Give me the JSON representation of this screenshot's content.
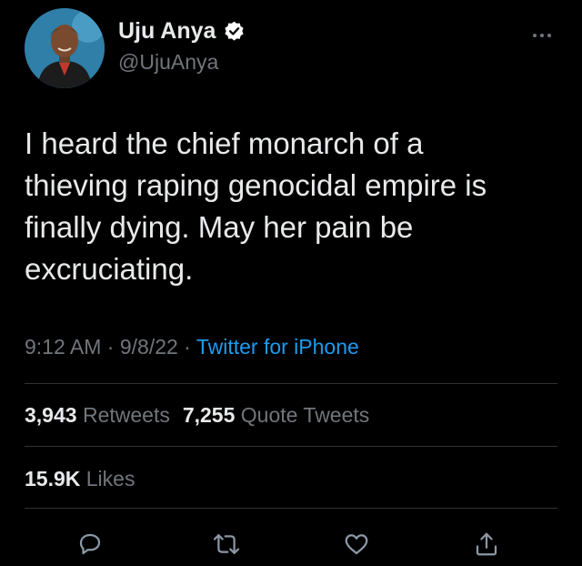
{
  "author": {
    "name": "Uju Anya",
    "handle": "@UjuAnya",
    "verified": true
  },
  "tweet": {
    "text": "I heard the chief monarch of a\nthieving raping genocidal empire is\nfinally dying. May her pain be\nexcruciating.",
    "time": "9:12 AM",
    "date": "9/8/22",
    "source": "Twitter for iPhone",
    "separator": " · "
  },
  "stats": {
    "retweets_count": "3,943",
    "retweets_label": "Retweets",
    "quotes_count": "7,255",
    "quotes_label": "Quote Tweets",
    "likes_count": "15.9K",
    "likes_label": "Likes"
  },
  "icons": {
    "reply": "reply-icon",
    "retweet": "retweet-icon",
    "like": "heart-icon",
    "share": "share-icon",
    "more": "more-icon",
    "verified": "verified-badge-icon"
  },
  "colors": {
    "background": "#000000",
    "text": "#e7e9ea",
    "secondary": "#71767b",
    "link": "#1d9bf0",
    "divider": "#2f3336"
  }
}
